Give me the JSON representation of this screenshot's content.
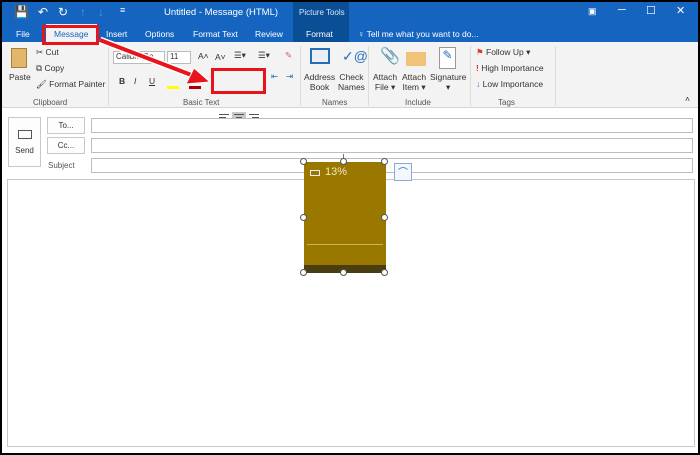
{
  "window": {
    "title": "Untitled - Message (HTML)",
    "context_group": "Picture Tools"
  },
  "tabs": [
    {
      "label": "File"
    },
    {
      "label": "Message"
    },
    {
      "label": "Insert"
    },
    {
      "label": "Options"
    },
    {
      "label": "Format Text"
    },
    {
      "label": "Review"
    },
    {
      "label": "Format"
    }
  ],
  "tell_me": "Tell me what you want to do...",
  "ribbon": {
    "clipboard": {
      "paste": "Paste",
      "cut": "Cut",
      "copy": "Copy",
      "format_painter": "Format Painter",
      "label": "Clipboard"
    },
    "basic_text": {
      "font": "Calibri (Bo",
      "size": "11",
      "bold": "B",
      "italic": "I",
      "underline": "U",
      "label": "Basic Text"
    },
    "names": {
      "address_book": [
        "Address",
        "Book"
      ],
      "check_names": [
        "Check",
        "Names"
      ],
      "label": "Names"
    },
    "include": {
      "attach_file": [
        "Attach",
        "File ▾"
      ],
      "attach_item": [
        "Attach",
        "Item ▾"
      ],
      "signature": "Signature",
      "label": "Include"
    },
    "tags": {
      "follow_up": "Follow Up ▾",
      "high": "High Importance",
      "low": "Low Importance",
      "label": "Tags"
    }
  },
  "compose": {
    "send": "Send",
    "to": "To...",
    "cc": "Cc...",
    "subject": "Subject",
    "to_value": "",
    "cc_value": "",
    "subject_value": ""
  },
  "image": {
    "percent": "13%",
    "image_color": "#9a7800"
  },
  "colors": {
    "title_bar": "#1565c0",
    "highlight": "#e8141b"
  }
}
